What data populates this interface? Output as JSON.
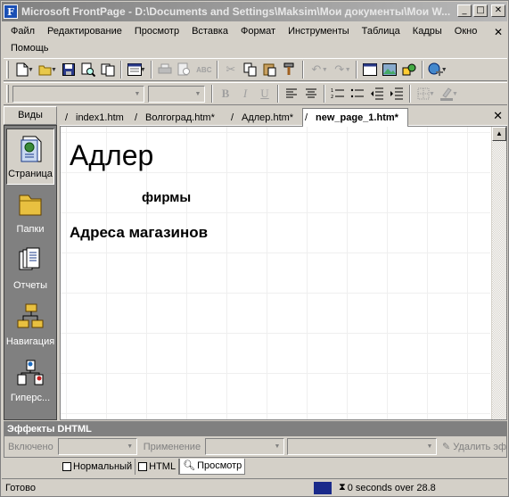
{
  "app": {
    "title": "Microsoft FrontPage - D:\\Documents and Settings\\Maksim\\Мои документы\\Мои W...",
    "title_buttons": {
      "minimize": "_",
      "maximize": "□",
      "close": "✕"
    }
  },
  "menu": {
    "items": [
      "Файл",
      "Редактирование",
      "Просмотр",
      "Вставка",
      "Формат",
      "Инструменты",
      "Таблица",
      "Кадры",
      "Окно",
      "Помощь"
    ],
    "close_glyph": "✕"
  },
  "views": {
    "header": "Виды",
    "items": [
      {
        "label": "Страница",
        "icon": "page-view-icon",
        "selected": true
      },
      {
        "label": "Папки",
        "icon": "folder-view-icon",
        "selected": false
      },
      {
        "label": "Отчеты",
        "icon": "reports-view-icon",
        "selected": false
      },
      {
        "label": "Навигация",
        "icon": "navigation-view-icon",
        "selected": false
      },
      {
        "label": "Гиперс...",
        "icon": "hyperlinks-view-icon",
        "selected": false
      }
    ]
  },
  "doc_tabs": {
    "tabs": [
      "index1.htm",
      "Волгоград.htm*",
      "Адлер.htm*",
      "new_page_1.htm*"
    ],
    "active_index": 3,
    "close_glyph": "✕"
  },
  "document": {
    "heading1": "Адлер",
    "subtitle": "фирмы",
    "heading2": "Адреса магазинов"
  },
  "dhtml": {
    "title": "Эффекты DHTML",
    "on_label": "Включено",
    "apply_label": "Применение",
    "remove_label": "Удалить эф"
  },
  "mode_tabs": {
    "tabs": [
      "Нормальный",
      "HTML",
      "Просмотр"
    ],
    "active_index": 2
  },
  "status": {
    "text": "Готово",
    "time": "0 seconds over 28.8"
  }
}
